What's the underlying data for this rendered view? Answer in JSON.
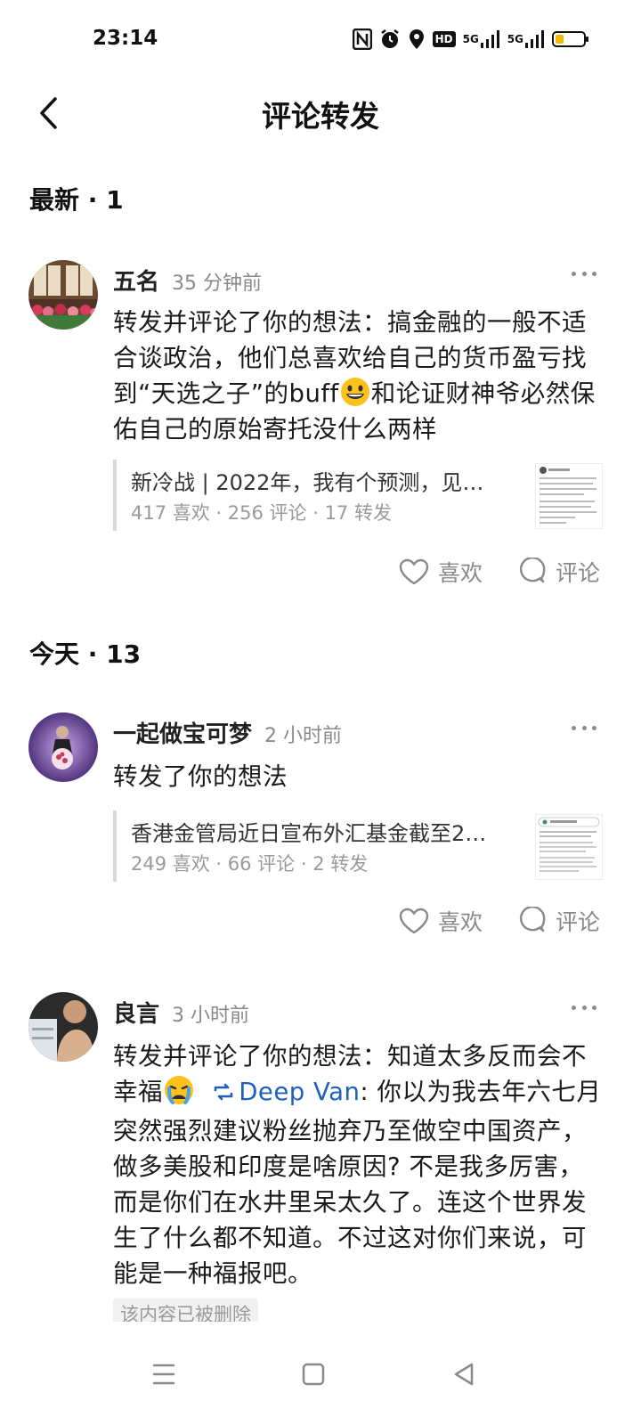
{
  "status_bar": {
    "time": "23:14",
    "icons": [
      "nfc-icon",
      "alarm-icon",
      "location-icon",
      "hd-icon",
      "signal-5g-icon",
      "signal-5g-icon",
      "battery-icon"
    ],
    "hd_label": "HD",
    "net1": "5G",
    "net2": "5G",
    "battery_color": "#f2b705"
  },
  "header": {
    "title": "评论转发",
    "back_icon": "chevron-left-icon"
  },
  "sections": [
    {
      "label": "最新 · 1"
    },
    {
      "label": "今天 · 13"
    }
  ],
  "comments": [
    {
      "user": "五名",
      "time": "35 分钟前",
      "text_a": "转发并评论了你的想法：搞金融的一般不适合谈政治，他们总喜欢给自己的货币盈亏找到“天选之子”的buff",
      "text_b": "和论证财神爷必然保佑自己的原始寄托没什么两样",
      "emoji": "grinning-emoji",
      "quote": {
        "title": "新冷战 | 2022年，我有个预测，见…",
        "stats": "417  喜欢 · 256  评论 · 17  转发"
      },
      "like_label": "喜欢",
      "comment_label": "评论"
    },
    {
      "user": "一起做宝可梦",
      "time": "2 小时前",
      "text": "转发了你的想法",
      "quote": {
        "title": "香港金管局近日宣布外汇基金截至2…",
        "stats": "249  喜欢 · 66  评论 · 2  转发"
      },
      "like_label": "喜欢",
      "comment_label": "评论"
    },
    {
      "user": "良言",
      "time": "3 小时前",
      "text_a": "转发并评论了你的想法：知道太多反而会不幸福",
      "emoji": "crying-emoji",
      "repost_icon": "repost-icon",
      "link_user": "Deep Van",
      "text_b": ": 你以为我去年六七月突然强烈建议粉丝抛弃乃至做空中国资产，做多美股和印度是啥原因? 不是我多厉害，而是你们在水井里呆太久了。连这个世界发生了什么都不知道。不过这对你们来说，可能是一种福报吧。",
      "deleted_label": "该内容已被删除"
    }
  ],
  "nav": {
    "icons": [
      "menu-icon",
      "home-square-icon",
      "back-triangle-icon"
    ]
  }
}
